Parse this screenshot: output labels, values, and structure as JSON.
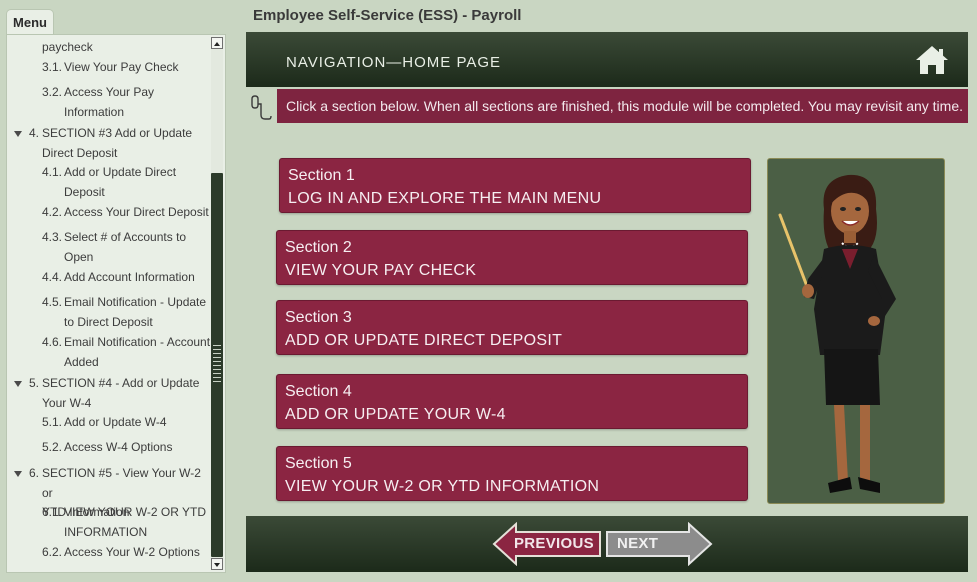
{
  "app": {
    "title": "Employee Self-Service (ESS) - Payroll"
  },
  "sidebar": {
    "tab_label": "Menu",
    "items": [
      {
        "num": "",
        "text": "paycheck"
      },
      {
        "num": "3.1.",
        "text": "View Your Pay Check"
      },
      {
        "num": "3.2.",
        "text": "Access Your Pay"
      },
      {
        "num": "",
        "text": "Information"
      },
      {
        "num": "4.",
        "text": "SECTION #3 Add or Update"
      },
      {
        "num": "",
        "text": "Direct Deposit"
      },
      {
        "num": "4.1.",
        "text": "Add or Update Direct"
      },
      {
        "num": "",
        "text": "Deposit"
      },
      {
        "num": "4.2.",
        "text": "Access Your Direct Deposit"
      },
      {
        "num": "4.3.",
        "text": "Select # of Accounts to"
      },
      {
        "num": "",
        "text": "Open"
      },
      {
        "num": "4.4.",
        "text": "Add Account Information"
      },
      {
        "num": "4.5.",
        "text": "Email Notification - Update"
      },
      {
        "num": "",
        "text": "to Direct Deposit"
      },
      {
        "num": "4.6.",
        "text": "Email Notification - Account"
      },
      {
        "num": "",
        "text": "Added"
      },
      {
        "num": "5.",
        "text": "SECTION #4 - Add or Update"
      },
      {
        "num": "",
        "text": "Your  W-4"
      },
      {
        "num": "5.1.",
        "text": "Add or Update W-4"
      },
      {
        "num": "5.2.",
        "text": "Access W-4 Options"
      },
      {
        "num": "6.",
        "text": "SECTION #5 - View Your W-2 or"
      },
      {
        "num": "",
        "text": "YTD Information"
      },
      {
        "num": "6.1.",
        "text": "VIEW YOUR W-2 OR YTD"
      },
      {
        "num": "",
        "text": "INFORMATION"
      },
      {
        "num": "6.2.",
        "text": "Access Your W-2 Options"
      }
    ]
  },
  "header": {
    "title": "NAVIGATION—HOME PAGE",
    "home_icon": "home-icon"
  },
  "instruction": {
    "text": "Click a section below. When all sections are finished, this module will be completed.  You may revisit any time."
  },
  "sections": [
    {
      "label": "Section 1",
      "title": "LOG IN AND EXPLORE THE MAIN MENU"
    },
    {
      "label": "Section 2",
      "title": "VIEW YOUR PAY CHECK"
    },
    {
      "label": "Section 3",
      "title": "ADD OR UPDATE DIRECT DEPOSIT"
    },
    {
      "label": "Section 4",
      "title": "ADD OR UPDATE YOUR W-4"
    },
    {
      "label": "Section 5",
      "title": "VIEW YOUR W-2 OR YTD INFORMATION"
    }
  ],
  "footer": {
    "prev_label": "PREVIOUS",
    "next_label": "NEXT"
  },
  "colors": {
    "accent": "#8b2542",
    "header_dark": "#1c2a1a",
    "page_bg": "#c9d6c2",
    "presenter_bg": "#4b5f45"
  }
}
